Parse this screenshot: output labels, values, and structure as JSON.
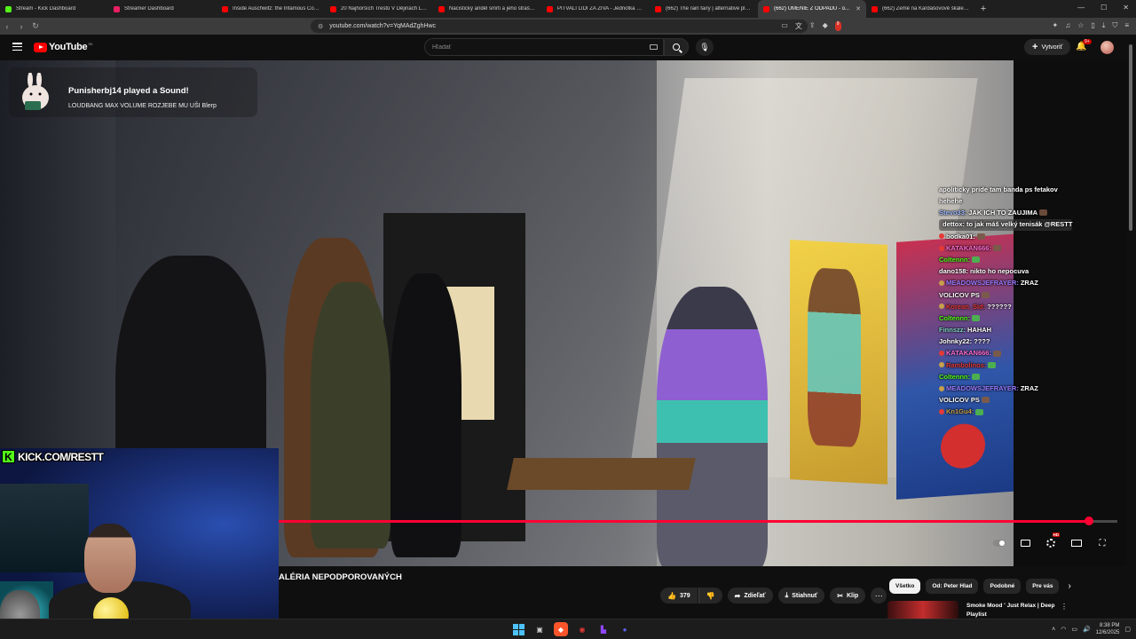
{
  "browser": {
    "tabs": [
      {
        "title": "Stream - Kick Dashboard",
        "favicon_color": "#53fc18",
        "active": false
      },
      {
        "title": "Streamer Dashboard",
        "favicon_color": "#e91e63",
        "active": false
      },
      {
        "title": "Inside Auschwitz: the Infamous Conc...",
        "favicon_color": "#ff0000",
        "active": false
      },
      {
        "title": "20 Najhorších Trestů V Dějinách Lidst...",
        "favicon_color": "#ff0000",
        "active": false
      },
      {
        "title": "Nacistický anděl smrti a jeho strašliv...",
        "favicon_color": "#ff0000",
        "active": false
      },
      {
        "title": "PITVALI LIDI ZA ŽIVA - Jednotka 731",
        "favicon_color": "#ff0000",
        "active": false
      },
      {
        "title": "(662) The rain fairy | alternative playli...",
        "favicon_color": "#ff0000",
        "active": false
      },
      {
        "title": "(662) UMENIE Z ODPADU - o...",
        "favicon_color": "#ff0000",
        "active": true
      },
      {
        "title": "(662) Země na Kardašovově škále - Yo...",
        "favicon_color": "#ff0000",
        "active": false
      }
    ],
    "new_tab": "+",
    "url": "youtube.com/watch?v=YqMAdZghHwc",
    "ext_badge": "9"
  },
  "youtube": {
    "logo_text": "YouTube",
    "logo_country": "SK",
    "search_placeholder": "Hľadať",
    "create_label": "Vytvoriť",
    "notif_badge": "9+"
  },
  "alert": {
    "title": "Punisherbj14 played a Sound!",
    "message": "LOUDBANG MAX VOLUME ROZJEBE MU UŠI Blerp"
  },
  "chat": [
    {
      "user": "",
      "text": "apoliticky pride tam banda ps fetakov",
      "user_color": "#ffffff",
      "badge": "",
      "emote": ""
    },
    {
      "user": "",
      "text": "hehehe",
      "user_color": "#ffffff",
      "badge": "",
      "emote": ""
    },
    {
      "user": "Stevo33:",
      "text": "JAK ICH TO ZAUJIMA",
      "user_color": "#9bb7ff",
      "badge": "",
      "emote": "#6b4a3a"
    },
    {
      "user": "dettox:",
      "text": "to jak máš velký tenisák @RESTT",
      "user_color": "#ffffff",
      "badge": "#c8a04a",
      "emote": "",
      "highlight": true
    },
    {
      "user": "bodka01:",
      "text": "",
      "user_color": "#ffffff",
      "badge": "#e53935",
      "emote": "#7a5a4a"
    },
    {
      "user": "KATAKAN666:",
      "text": "",
      "user_color": "#ff6bd1",
      "badge": "#e53935",
      "emote": "#7a5a4a"
    },
    {
      "user": "Coltennn:",
      "text": "",
      "user_color": "#53fc18",
      "badge": "",
      "emote": "#4caf50"
    },
    {
      "user": "dano158:",
      "text": "nikto ho nepocuva",
      "user_color": "#ffffff",
      "badge": "",
      "emote": ""
    },
    {
      "user": "MEADOWSJEFRAYER:",
      "text": "ZRAZ",
      "user_color": "#9b7bff",
      "badge": "#c8a04a",
      "emote": ""
    },
    {
      "user": "",
      "text": "VOLICOV PS",
      "user_color": "#ffffff",
      "badge": "",
      "emote": "#7a5a4a"
    },
    {
      "user": "Korean_Sid:",
      "text": "??????",
      "user_color": "#e53935",
      "badge": "#c8a04a",
      "emote": ""
    },
    {
      "user": "Coltennn:",
      "text": "",
      "user_color": "#53fc18",
      "badge": "",
      "emote": "#4caf50"
    },
    {
      "user": "Finnszz:",
      "text": "HAHAH",
      "user_color": "#7dd3c0",
      "badge": "",
      "emote": ""
    },
    {
      "user": "Johnky22:",
      "text": "????",
      "user_color": "#ffffff",
      "badge": "",
      "emote": ""
    },
    {
      "user": "KATAKAN666:",
      "text": "",
      "user_color": "#ff6bd1",
      "badge": "#e53935",
      "emote": "#7a5a4a"
    },
    {
      "user": "Rambolinos:",
      "text": "",
      "user_color": "#e53935",
      "badge": "#c8a04a",
      "emote": "#4caf50"
    },
    {
      "user": "Coltennn:",
      "text": "",
      "user_color": "#53fc18",
      "badge": "",
      "emote": "#4caf50"
    },
    {
      "user": "MEADOWSJEFRAYER:",
      "text": "ZRAZ",
      "user_color": "#9b7bff",
      "badge": "#c8a04a",
      "emote": ""
    },
    {
      "user": "",
      "text": "VOLICOV PS",
      "user_color": "#ffffff",
      "badge": "",
      "emote": "#7a5a4a"
    },
    {
      "user": "Kn1Gu4:",
      "text": "",
      "user_color": "#c8a04a",
      "badge": "#e53935",
      "emote": "#4caf50"
    }
  ],
  "kick_banner": "KICK.COM/RESTT",
  "player": {
    "progress": 0.966,
    "hd_badge": "HD",
    "title": "ALÉRIA NEPODPOROVANÝCH"
  },
  "actions": {
    "likes": "379",
    "share": "Zdieľať",
    "download": "Stiahnuť",
    "clip": "Klip"
  },
  "chips": [
    "Všetko",
    "Od: Peter Hlad",
    "Podobné",
    "Pre vás"
  ],
  "recommendation": {
    "title": "Smoke Mood ' Just Relax | Deep",
    "subtitle": "Playlist"
  },
  "taskbar": {
    "time": "8:38 PM",
    "date": "12/6/2025"
  }
}
